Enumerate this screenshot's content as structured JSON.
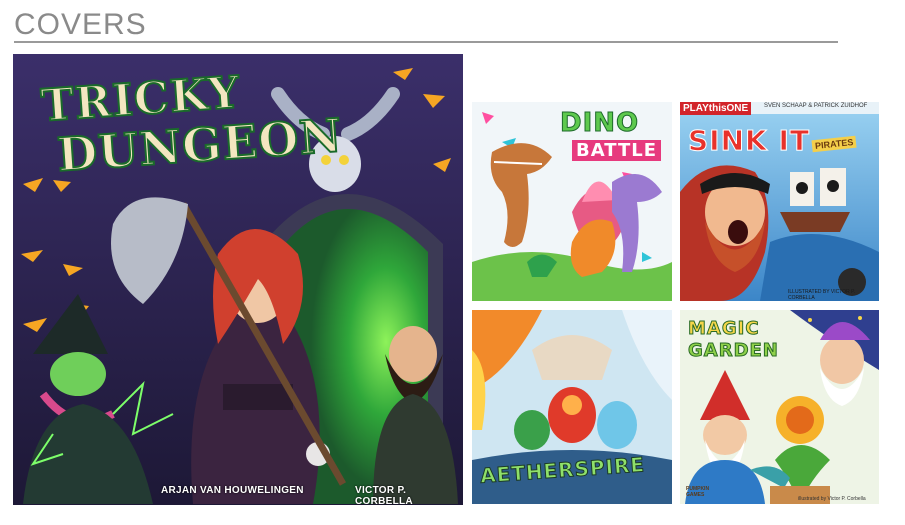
{
  "page": {
    "heading": "COVERS"
  },
  "covers": {
    "tricky_dungeon": {
      "title_line1": "TRICKY",
      "title_line2": "DUNGEON",
      "credit_left": "ARJAN VAN HOUWELINGEN",
      "credit_right": "VICTOR P. CORBELLA"
    },
    "dino_battle": {
      "title_line1": "DINO",
      "title_line2": "BATTLE"
    },
    "sink_it": {
      "publisher": "PLAYthisONE",
      "authors": "SVEN SCHAAP & PATRICK ZUIDHOF",
      "title": "SINK IT",
      "badge": "PIRATES",
      "illustrator": "ILLUSTRATED BY VICTOR P. CORBELLA"
    },
    "aetherspire": {
      "title": "AETHERSPIRE"
    },
    "magic_garden": {
      "title_line1": "MAGIC",
      "title_line2": "GARDEN",
      "publisher": "PUMPKIN GAMES",
      "illustrator": "illustrated by Victor P. Corbella"
    }
  },
  "colors": {
    "heading": "#8a8a8a",
    "rule": "#9a9a9a",
    "dungeon_bg": "#2b2148",
    "dungeon_green": "#4fd84a",
    "dungeon_title": "#f3e6c0",
    "dino_bg": "#f1f6f9",
    "sink_bg": "#5fa8d8",
    "aether_bg": "#cfe6f2",
    "garden_bg": "#eef4e6"
  }
}
